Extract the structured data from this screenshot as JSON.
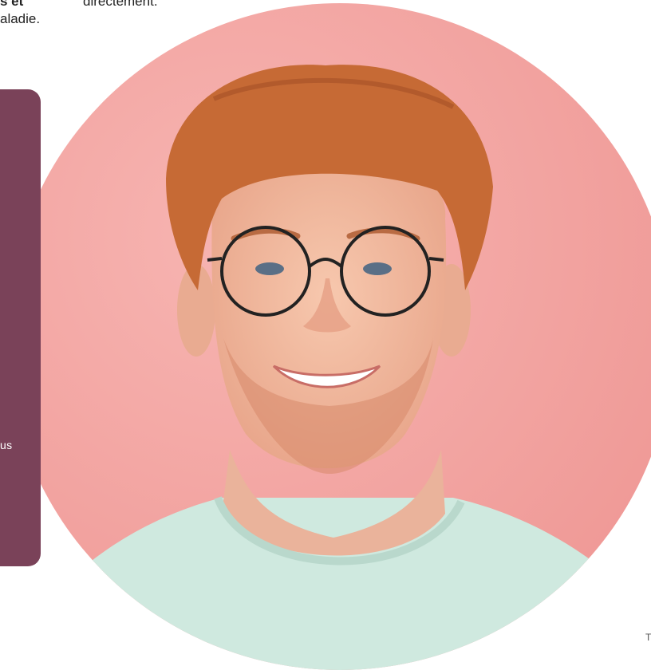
{
  "text_fragments": {
    "top_left_line1": "s et",
    "top_left_line2": "aladie.",
    "top_center": "directement.",
    "bottom_right": "T"
  },
  "side_card": {
    "text": "us",
    "color": "#7a4259"
  },
  "portrait": {
    "alt": "Smiling red-haired young man with round glasses and mint t-shirt",
    "background_color": "#f3a6a4",
    "shirt_color": "#cfe9df",
    "hair_color": "#c66a35"
  }
}
